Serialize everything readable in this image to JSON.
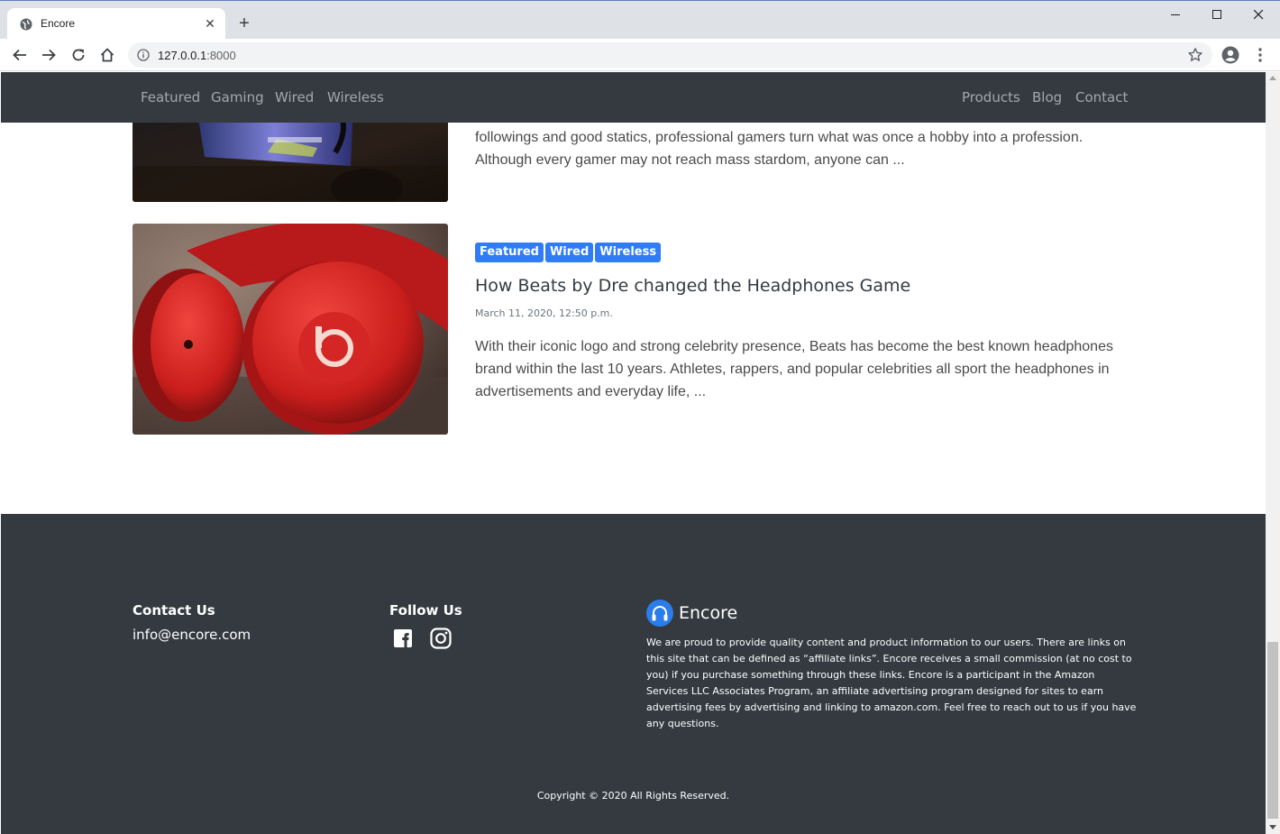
{
  "browser": {
    "tab_title": "Encore",
    "new_tab_symbol": "+",
    "close_symbol": "✕",
    "url_host": "127.0.0.1",
    "url_port": ":8000"
  },
  "nav": {
    "left": [
      "Featured",
      "Gaming",
      "Wired",
      "Wireless"
    ],
    "right": [
      "Products",
      "Blog",
      "Contact"
    ]
  },
  "posts": [
    {
      "excerpt_line1": "followings and good statics, professional gamers turn what was once a hobby into a profession.",
      "excerpt_line2": "Although every gamer may not reach mass stardom, anyone can ..."
    },
    {
      "tags": [
        "Featured",
        "Wired",
        "Wireless"
      ],
      "title": "How Beats by Dre changed the Headphones Game",
      "date": "March 11, 2020, 12:50 p.m.",
      "excerpt": "With their iconic logo and strong celebrity presence, Beats has become the best known headphones brand within the last 10 years. Athletes, rappers, and popular celebrities all sport the headphones in advertisements and everyday life, ..."
    }
  ],
  "footer": {
    "contact_heading": "Contact Us",
    "email": "info@encore.com",
    "follow_heading": "Follow Us",
    "brand": "Encore",
    "about": "We are proud to provide quality content and product information to our users. There are links on this site that can be defined as “affiliate links”. Encore receives a small commission (at no cost to you) if you purchase something through these links. Encore is a participant in the Amazon Services LLC Associates Program, an affiliate advertising program designed for sites to earn advertising fees by advertising and linking to amazon.com. Feel free to reach out to us if you have any questions.",
    "copyright": "Copyright © 2020 All Rights Reserved."
  },
  "colors": {
    "navbar": "#343a40",
    "badge": "#2f7cf6",
    "logo_blue": "#2b7de9"
  },
  "icons": [
    "globe-icon",
    "close-icon",
    "back-icon",
    "forward-icon",
    "reload-icon",
    "home-icon",
    "info-icon",
    "bookmark-star-icon",
    "profile-icon",
    "menu-icon",
    "facebook-icon",
    "instagram-icon",
    "headphones-logo-icon"
  ]
}
